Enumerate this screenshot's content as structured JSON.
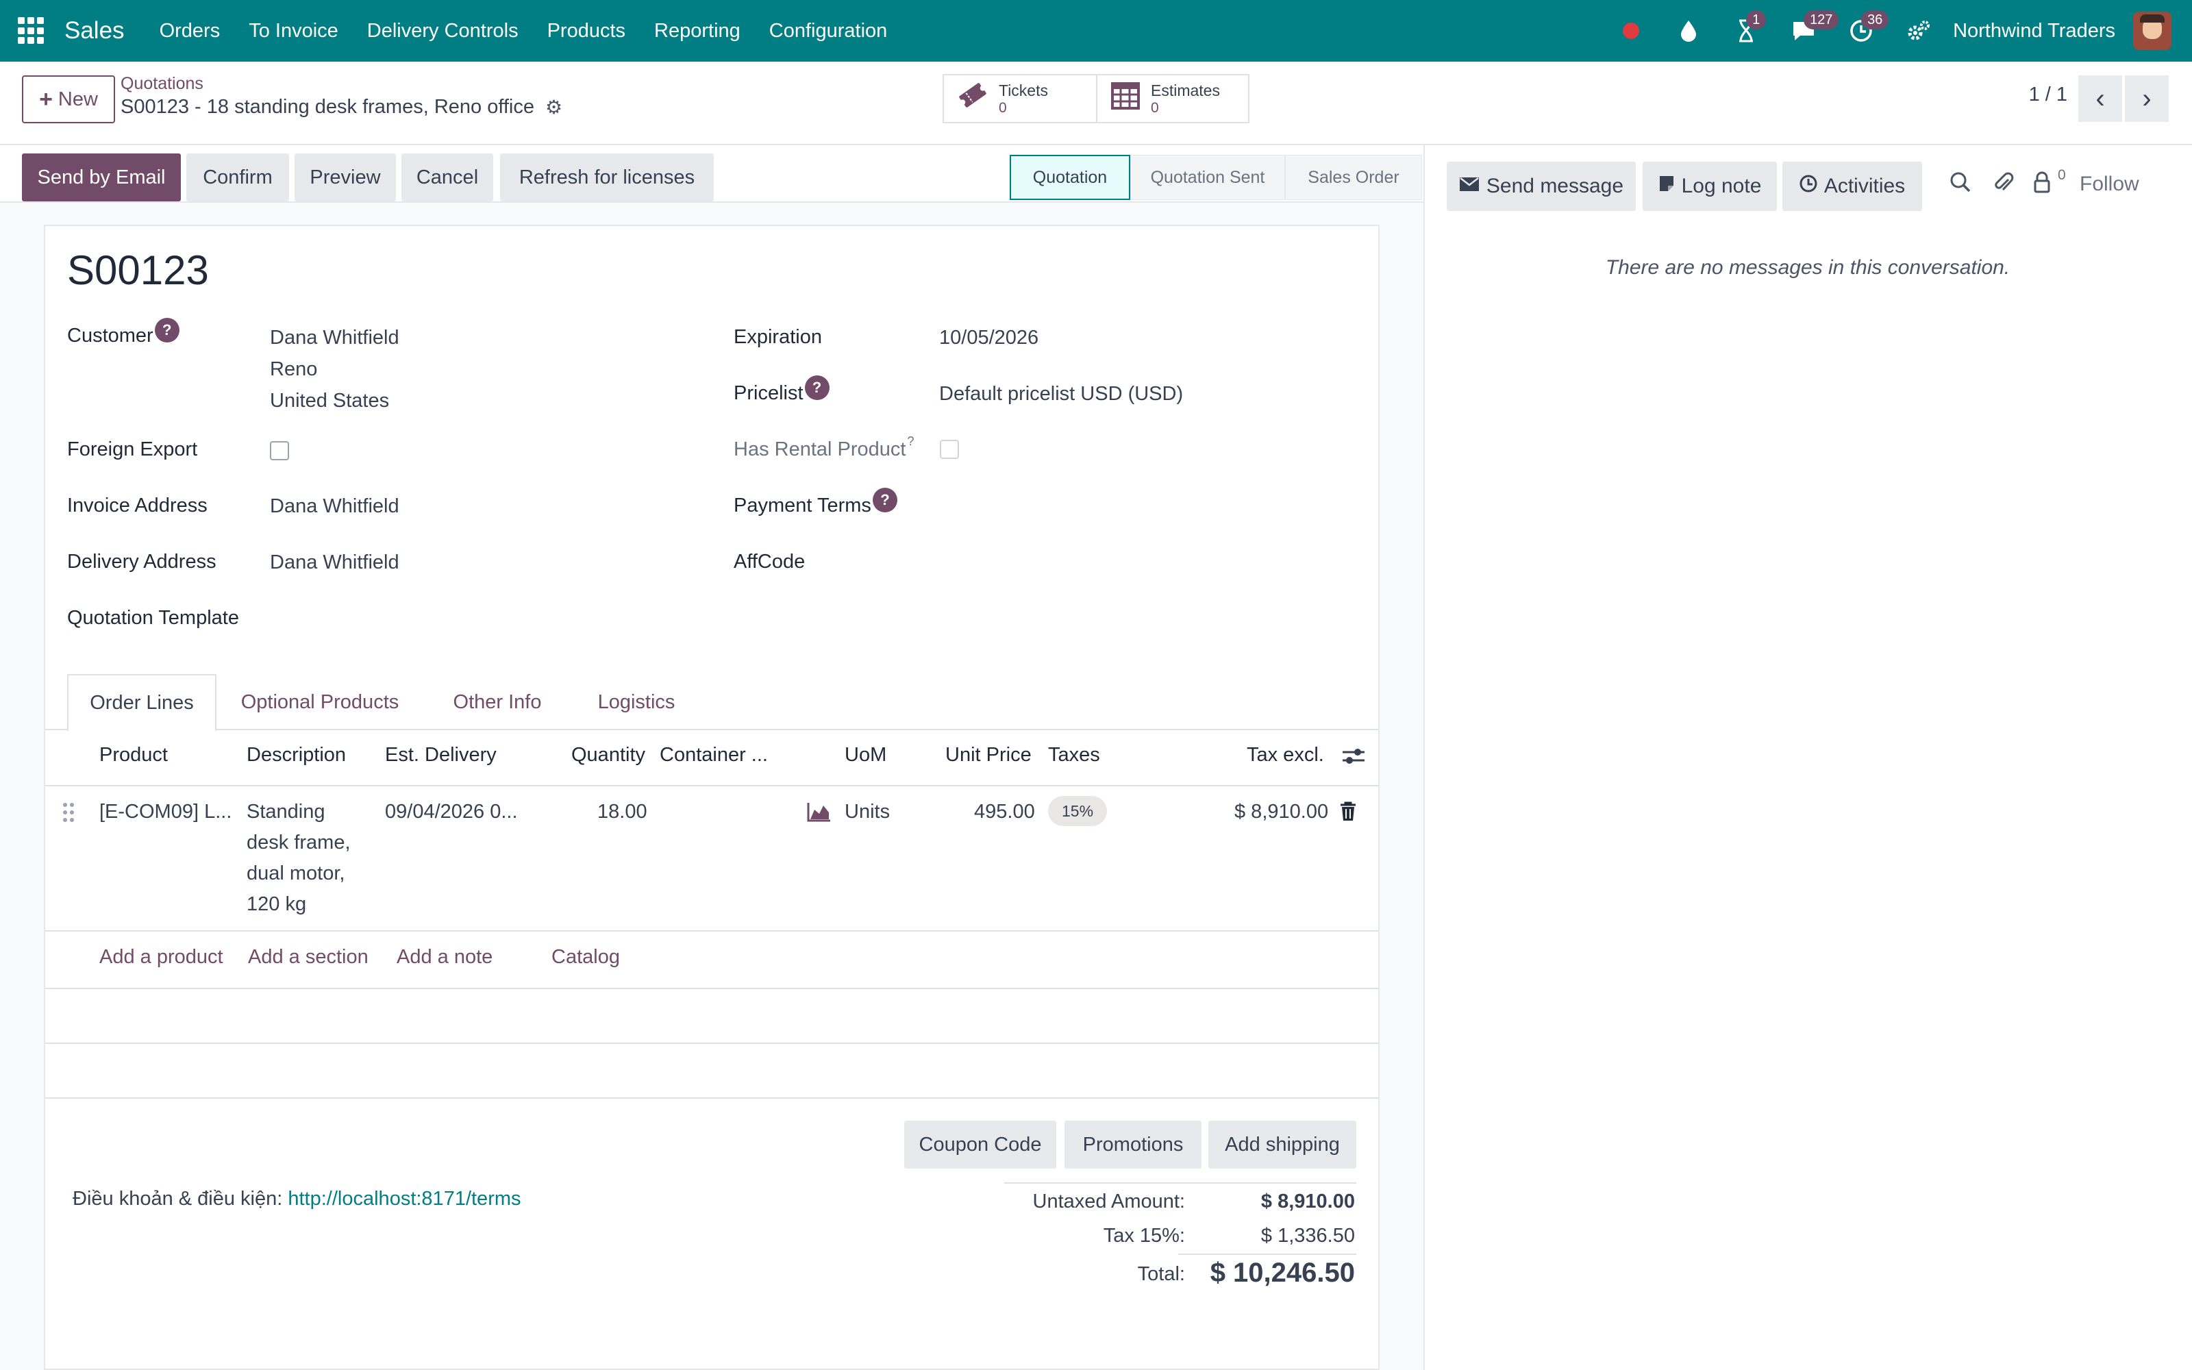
{
  "nav": {
    "brand": "Sales",
    "menus": [
      "Orders",
      "To Invoice",
      "Delivery Controls",
      "Products",
      "Reporting",
      "Configuration"
    ],
    "badges": {
      "activity": "1",
      "messages": "127",
      "clock": "36"
    },
    "company": "Northwind Traders"
  },
  "control": {
    "new_label": "New",
    "breadcrumb": "Quotations",
    "record_title": "S00123 - 18 standing desk frames, Reno office",
    "smart_buttons": [
      {
        "label": "Tickets",
        "value": "0",
        "icon": "ticket-icon"
      },
      {
        "label": "Estimates",
        "value": "0",
        "icon": "calendar-grid-icon"
      }
    ],
    "pager": "1 / 1"
  },
  "status_bar": {
    "buttons": [
      "Send by Email",
      "Confirm",
      "Preview",
      "Cancel",
      "Refresh for licenses"
    ],
    "stages": [
      "Quotation",
      "Quotation Sent",
      "Sales Order"
    ],
    "active_stage": "Quotation"
  },
  "form": {
    "name": "S00123",
    "help_mark": "?",
    "sup_mark": "?",
    "labels": {
      "customer": "Customer",
      "foreign_export": "Foreign Export",
      "invoice_address": "Invoice Address",
      "delivery_address": "Delivery Address",
      "quotation_template": "Quotation Template",
      "expiration": "Expiration",
      "pricelist": "Pricelist",
      "has_rental": "Has Rental Product",
      "payment_terms": "Payment Terms",
      "affcode": "AffCode"
    },
    "values": {
      "customer_name": "Dana Whitfield",
      "customer_city": "Reno",
      "customer_country": "United States",
      "invoice_address": "Dana Whitfield",
      "delivery_address": "Dana Whitfield",
      "expiration": "10/05/2026",
      "pricelist": "Default pricelist USD  (USD)"
    }
  },
  "tabs": [
    "Order Lines",
    "Optional Products",
    "Other Info",
    "Logistics"
  ],
  "order_lines": {
    "columns": [
      "Product",
      "Description",
      "Est. Delivery",
      "Quantity",
      "Container ...",
      "UoM",
      "Unit Price",
      "Taxes",
      "Tax excl."
    ],
    "rows": [
      {
        "product": "[E-COM09] L...",
        "description": [
          "Standing",
          "desk frame,",
          "dual motor,",
          "120 kg"
        ],
        "est_delivery": "09/04/2026 0...",
        "quantity": "18.00",
        "uom": "Units",
        "unit_price": "495.00",
        "taxes": "15%",
        "subtotal": "$ 8,910.00"
      }
    ],
    "add_links": [
      "Add a product",
      "Add a section",
      "Add a note",
      "Catalog"
    ]
  },
  "footer": {
    "buttons": [
      "Coupon Code",
      "Promotions",
      "Add shipping"
    ],
    "terms_label": "Điều khoản & điều kiện:",
    "terms_link": "http://localhost:8171/terms",
    "totals": {
      "untaxed_label": "Untaxed Amount:",
      "untaxed_value": "$ 8,910.00",
      "tax_label": "Tax 15%:",
      "tax_value": "$ 1,336.50",
      "total_label": "Total:",
      "total_value": "$ 10,246.50"
    }
  },
  "chatter": {
    "send_message": "Send message",
    "log_note": "Log note",
    "activities": "Activities",
    "followers_count": "0",
    "follow": "Follow",
    "empty_text": "There are no messages in this conversation."
  },
  "colors": {
    "nav_bg": "#017e84",
    "primary": "#714b67",
    "link": "#017e84"
  }
}
